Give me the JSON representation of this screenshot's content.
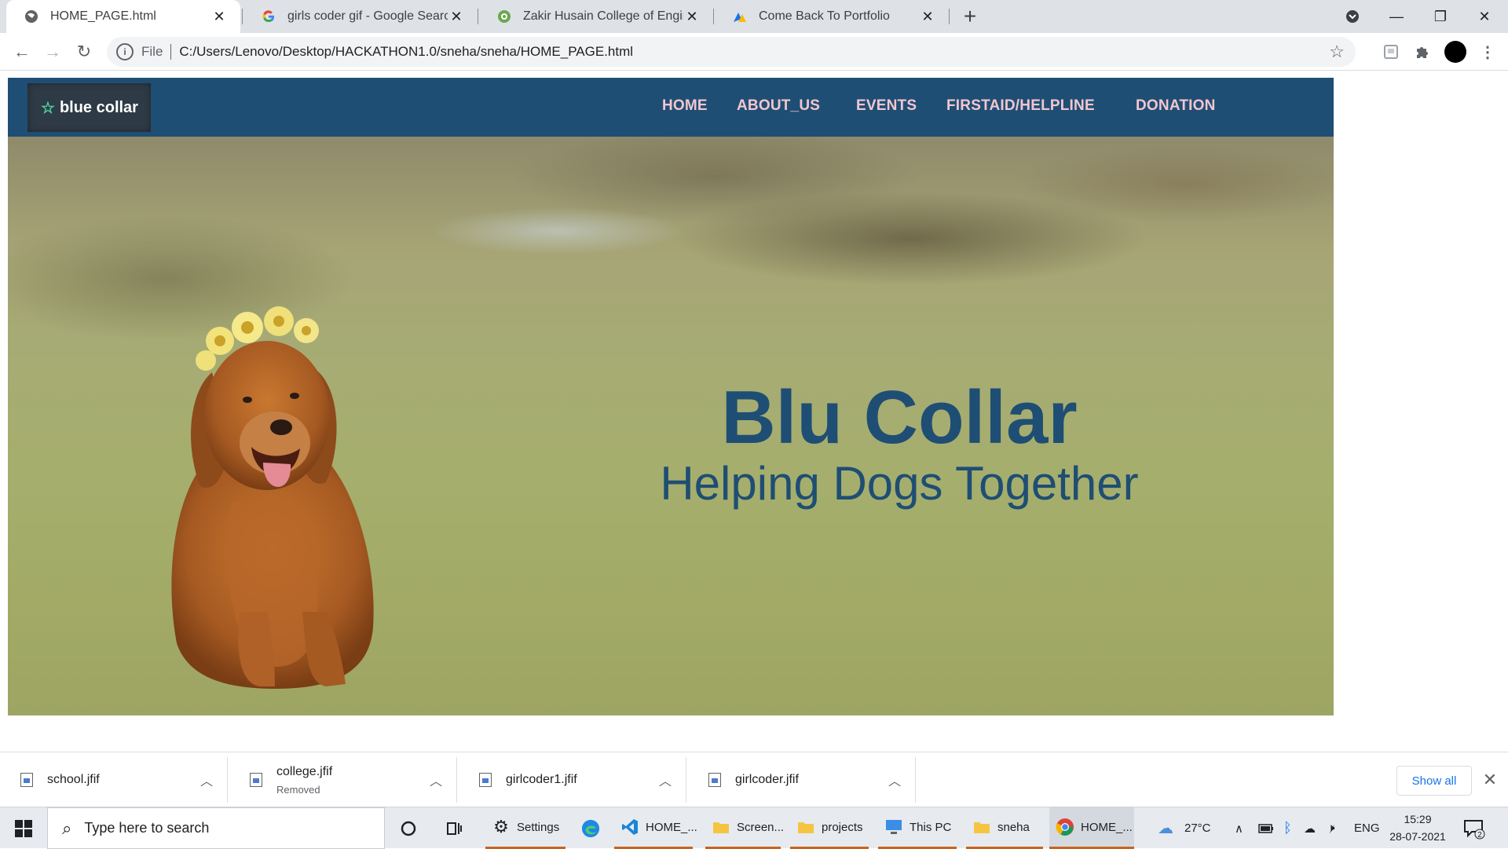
{
  "browser": {
    "tabs": [
      {
        "title": "HOME_PAGE.html",
        "icon": "globe-icon",
        "active": true
      },
      {
        "title": "girls coder gif - Google Search",
        "icon": "google-icon",
        "active": false
      },
      {
        "title": "Zakir Husain College of Engineeri",
        "icon": "college-icon",
        "active": false
      },
      {
        "title": "Come Back To Portfolio",
        "icon": "portfolio-icon",
        "active": false
      }
    ],
    "address": {
      "scheme": "File",
      "url": "C:/Users/Lenovo/Desktop/HACKATHON1.0/sneha/sneha/HOME_PAGE.html"
    }
  },
  "site": {
    "brand": "blue collar",
    "nav": [
      "HOME",
      "ABOUT_US",
      "EVENTS",
      "FIRSTAID/HELPLINE",
      "DONATION"
    ],
    "hero_title": "Blu Collar",
    "hero_subtitle": "Helping Dogs Together",
    "colors": {
      "nav_bg": "#1f4e74",
      "nav_link": "#f2c6cf",
      "hero_text": "#1f4e74"
    }
  },
  "downloads": {
    "items": [
      {
        "name": "school.jfif",
        "status": ""
      },
      {
        "name": "college.jfif",
        "status": "Removed"
      },
      {
        "name": "girlcoder1.jfif",
        "status": ""
      },
      {
        "name": "girlcoder.jfif",
        "status": ""
      }
    ],
    "show_all": "Show all"
  },
  "taskbar": {
    "search_placeholder": "Type here to search",
    "apps": [
      {
        "label": "",
        "icon": "cortana-icon"
      },
      {
        "label": "",
        "icon": "task-view-icon"
      },
      {
        "label": "Settings",
        "icon": "settings-icon"
      },
      {
        "label": "",
        "icon": "edge-icon"
      },
      {
        "label": "HOME_...",
        "icon": "vscode-icon"
      },
      {
        "label": "Screen...",
        "icon": "folder-icon"
      },
      {
        "label": "projects",
        "icon": "folder-icon"
      },
      {
        "label": "This PC",
        "icon": "this-pc-icon"
      },
      {
        "label": "sneha",
        "icon": "folder-icon"
      },
      {
        "label": "HOME_...",
        "icon": "chrome-icon"
      }
    ],
    "weather": "27°C",
    "language": "ENG",
    "time": "15:29",
    "date": "28-07-2021",
    "notification_count": "2"
  }
}
